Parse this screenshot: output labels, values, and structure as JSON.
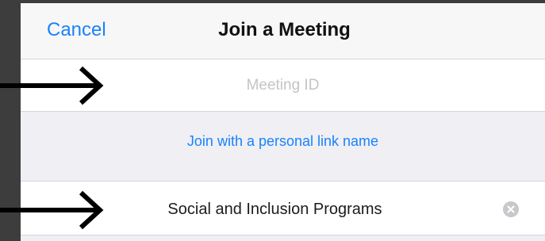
{
  "navbar": {
    "cancel_label": "Cancel",
    "title": "Join a Meeting"
  },
  "meeting_id": {
    "placeholder": "Meeting ID",
    "value": ""
  },
  "personal_link": {
    "label": "Join with a personal link name"
  },
  "name_field": {
    "value": "Social and Inclusion Programs",
    "clear_icon": "clear-circle-x"
  },
  "annotations": {
    "arrow_icon": "right-arrow",
    "arrow_color": "#000000"
  },
  "colors": {
    "accent": "#1a82fb",
    "background": "#efeff4",
    "frame": "#3d3d3d"
  }
}
